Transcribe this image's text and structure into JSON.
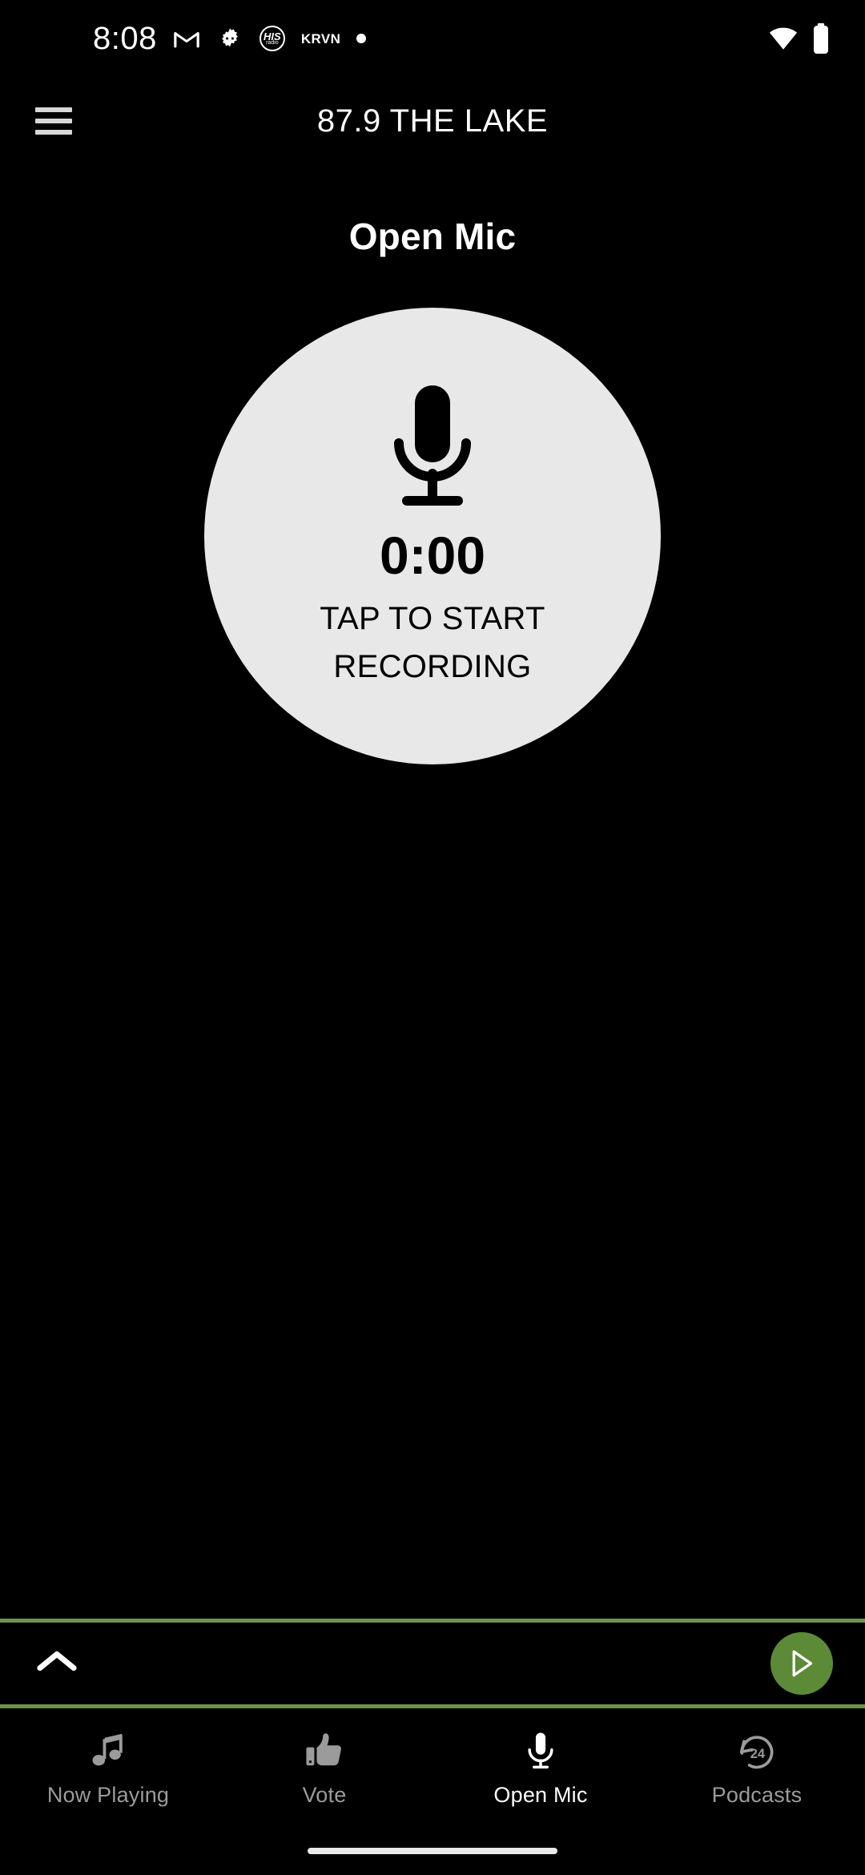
{
  "status_bar": {
    "time": "8:08",
    "left_icons": [
      {
        "name": "gmail-icon",
        "label": "M"
      },
      {
        "name": "settings-gear-icon",
        "label": ""
      },
      {
        "name": "his-radio-icon",
        "label_top": "HIS",
        "label_bottom": "radio"
      },
      {
        "name": "krvn-icon",
        "label": "KRVN"
      },
      {
        "name": "notification-dot-icon",
        "label": ""
      }
    ],
    "right_icons": [
      {
        "name": "wifi-icon",
        "label": ""
      },
      {
        "name": "battery-icon",
        "label": ""
      }
    ]
  },
  "app_bar": {
    "menu_icon": "hamburger-menu-icon",
    "title": "87.9 THE LAKE"
  },
  "main": {
    "page_title": "Open Mic",
    "record_button": {
      "icon": "microphone-icon",
      "timer": "0:00",
      "hint_line_1": "TAP TO START",
      "hint_line_2": "RECORDING",
      "circle_color": "#e8e8e8"
    }
  },
  "mini_player": {
    "expand_icon": "chevron-up-icon",
    "play_icon": "play-triangle-icon",
    "play_button_color": "#5d8a36",
    "border_color": "#6f9150"
  },
  "bottom_nav": {
    "active_index": 2,
    "items": [
      {
        "label": "Now Playing",
        "icon": "music-note-icon"
      },
      {
        "label": "Vote",
        "icon": "thumbs-up-icon"
      },
      {
        "label": "Open Mic",
        "icon": "microphone-icon"
      },
      {
        "label": "Podcasts",
        "icon": "clock-24-icon"
      }
    ]
  },
  "gesture_bar": {
    "handle": "home-gesture-pill"
  }
}
